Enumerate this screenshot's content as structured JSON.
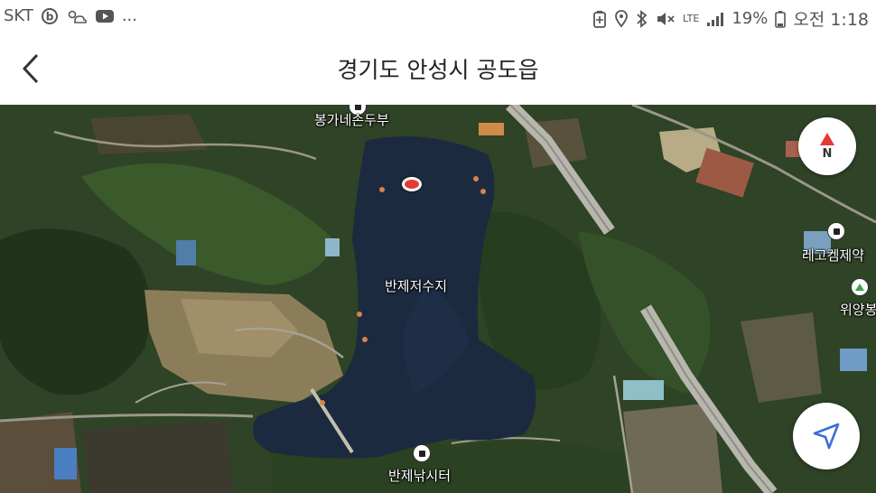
{
  "status_bar": {
    "carrier": "SKT",
    "icons_left": [
      "b-app-icon",
      "weather-icon",
      "youtube-icon"
    ],
    "more": "...",
    "network_label": "LTE",
    "battery_percent": "19%",
    "time": "오전 1:18",
    "icons_right": [
      "battery-saver-icon",
      "location-icon",
      "bluetooth-icon",
      "mute-icon",
      "signal-icon",
      "battery-icon"
    ]
  },
  "header": {
    "title": "경기도 안성시 공도읍",
    "back_icon": "chevron-left-icon"
  },
  "map": {
    "view_type": "satellite",
    "labels": {
      "poi_top": "봉가네손두부",
      "reservoir": "반제저수지",
      "poi_bottom": "반제낚시터",
      "poi_right_1": "레고켐제약",
      "poi_right_2": "위양봉"
    },
    "compass_label": "N",
    "colors": {
      "water": "#1b2a3e",
      "forest": "#2f4a24",
      "field": "#8a7a55",
      "road": "#b9b9b0",
      "pin": "#e53935",
      "compass_red": "#e53935",
      "locate_icon": "#3b6fd4"
    }
  }
}
